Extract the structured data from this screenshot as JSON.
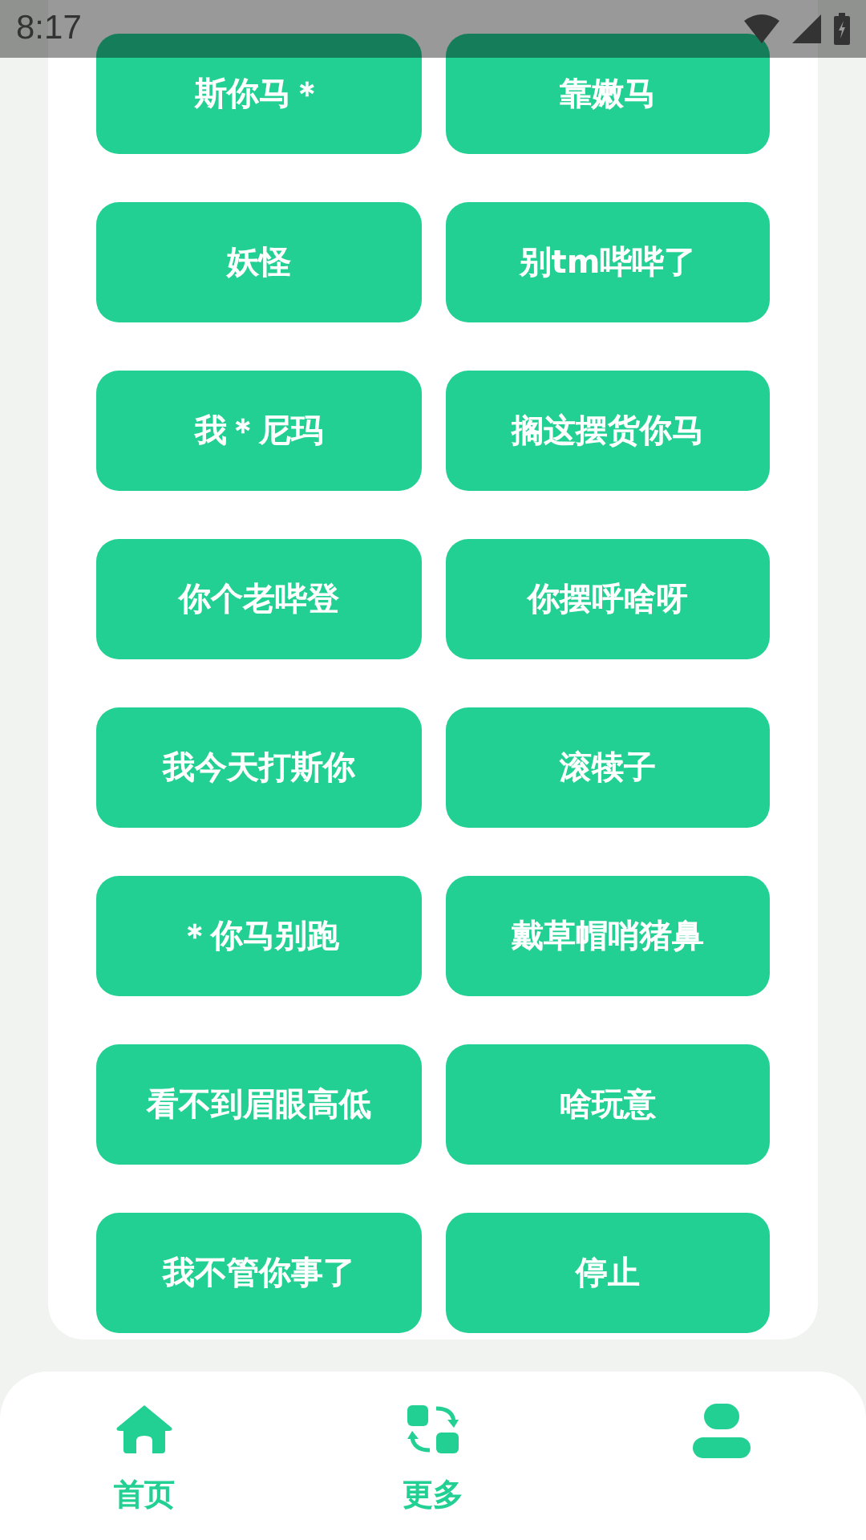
{
  "status_bar": {
    "time": "8:17"
  },
  "buttons": [
    "斯你马＊",
    "靠嫩马",
    "妖怪",
    "别tm哔哔了",
    "我＊尼玛",
    "搁这摆货你马",
    "你个老哔登",
    "你摆呼啥呀",
    "我今天打斯你",
    "滚犊子",
    "＊你马别跑",
    "戴草帽哨猪鼻",
    "看不到眉眼高低",
    "啥玩意",
    "我不管你事了",
    "停止"
  ],
  "nav": [
    {
      "kind": "home",
      "label": "首页"
    },
    {
      "kind": "more",
      "label": "更多"
    },
    {
      "kind": "profile"
    }
  ]
}
